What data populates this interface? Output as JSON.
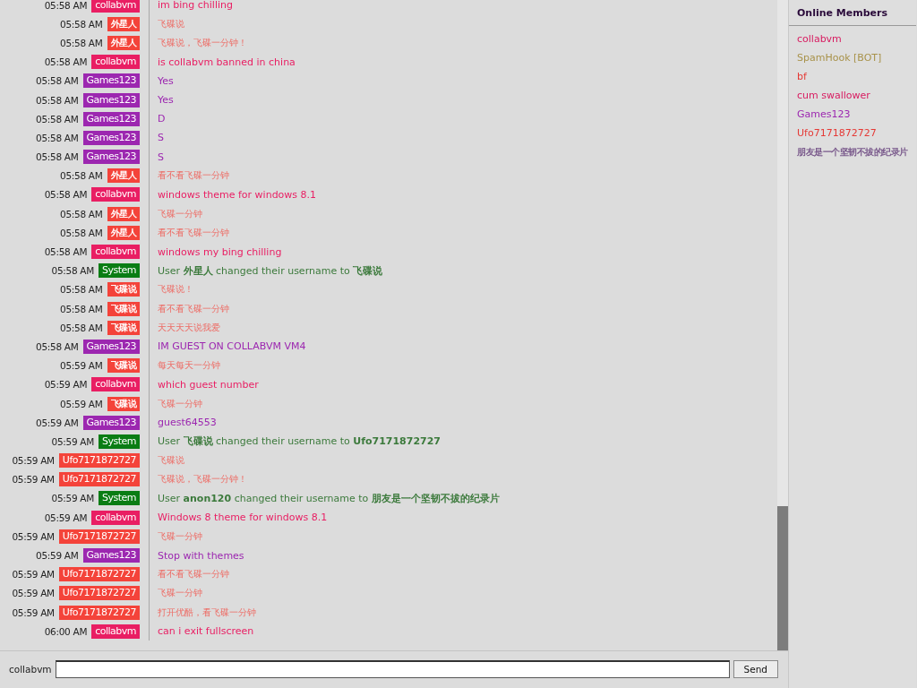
{
  "messages": [
    {
      "time": "05:58 AM",
      "user": "collabvm",
      "color": "#e91e63",
      "kind": "chat",
      "text": "im bing chilling"
    },
    {
      "time": "05:58 AM",
      "user": "外星人",
      "color": "#f4433a",
      "kind": "chat",
      "text": "飞碟说"
    },
    {
      "time": "05:58 AM",
      "user": "外星人",
      "color": "#f4433a",
      "kind": "chat",
      "text": "飞碟说，飞碟一分钟！"
    },
    {
      "time": "05:58 AM",
      "user": "collabvm",
      "color": "#e91e63",
      "kind": "chat",
      "text": "is collabvm banned in china"
    },
    {
      "time": "05:58 AM",
      "user": "Games123",
      "color": "#9c27b0",
      "kind": "chat",
      "text": "Yes"
    },
    {
      "time": "05:58 AM",
      "user": "Games123",
      "color": "#9c27b0",
      "kind": "chat",
      "text": "Yes"
    },
    {
      "time": "05:58 AM",
      "user": "Games123",
      "color": "#9c27b0",
      "kind": "chat",
      "text": "D"
    },
    {
      "time": "05:58 AM",
      "user": "Games123",
      "color": "#9c27b0",
      "kind": "chat",
      "text": "S"
    },
    {
      "time": "05:58 AM",
      "user": "Games123",
      "color": "#9c27b0",
      "kind": "chat",
      "text": "S"
    },
    {
      "time": "05:58 AM",
      "user": "外星人",
      "color": "#f4433a",
      "kind": "chat",
      "text": "看不看飞碟一分钟"
    },
    {
      "time": "05:58 AM",
      "user": "collabvm",
      "color": "#e91e63",
      "kind": "chat",
      "text": "windows theme for windows 8.1"
    },
    {
      "time": "05:58 AM",
      "user": "外星人",
      "color": "#f4433a",
      "kind": "chat",
      "text": "飞碟一分钟"
    },
    {
      "time": "05:58 AM",
      "user": "外星人",
      "color": "#f4433a",
      "kind": "chat",
      "text": "看不看飞碟一分钟"
    },
    {
      "time": "05:58 AM",
      "user": "collabvm",
      "color": "#e91e63",
      "kind": "chat",
      "text": "windows my bing chilling"
    },
    {
      "time": "05:58 AM",
      "user": "System",
      "color": "#0a7d14",
      "kind": "system",
      "text": "User **外星人** changed their username to **飞碟说**"
    },
    {
      "time": "05:58 AM",
      "user": "飞碟说",
      "color": "#f4433a",
      "kind": "chat",
      "text": "飞碟说！"
    },
    {
      "time": "05:58 AM",
      "user": "飞碟说",
      "color": "#f4433a",
      "kind": "chat",
      "text": "看不看飞碟一分钟"
    },
    {
      "time": "05:58 AM",
      "user": "飞碟说",
      "color": "#f4433a",
      "kind": "chat",
      "text": "天天天天说我爱"
    },
    {
      "time": "05:58 AM",
      "user": "Games123",
      "color": "#9c27b0",
      "kind": "chat",
      "text": "IM GUEST ON COLLABVM VM4"
    },
    {
      "time": "05:59 AM",
      "user": "飞碟说",
      "color": "#f4433a",
      "kind": "chat",
      "text": "每天每天一分钟"
    },
    {
      "time": "05:59 AM",
      "user": "collabvm",
      "color": "#e91e63",
      "kind": "chat",
      "text": "which guest number"
    },
    {
      "time": "05:59 AM",
      "user": "飞碟说",
      "color": "#f4433a",
      "kind": "chat",
      "text": "飞碟一分钟"
    },
    {
      "time": "05:59 AM",
      "user": "Games123",
      "color": "#9c27b0",
      "kind": "chat",
      "text": "guest64553"
    },
    {
      "time": "05:59 AM",
      "user": "System",
      "color": "#0a7d14",
      "kind": "system",
      "text": "User **飞碟说** changed their username to **Ufo7171872727**"
    },
    {
      "time": "05:59 AM",
      "user": "Ufo7171872727",
      "color": "#f4433a",
      "kind": "chat",
      "text": "飞碟说"
    },
    {
      "time": "05:59 AM",
      "user": "Ufo7171872727",
      "color": "#f4433a",
      "kind": "chat",
      "text": "飞碟说，飞碟一分钟！"
    },
    {
      "time": "05:59 AM",
      "user": "System",
      "color": "#0a7d14",
      "kind": "system",
      "text": "User **anon120** changed their username to **朋友是一个坚韧不拔的纪录片**"
    },
    {
      "time": "05:59 AM",
      "user": "collabvm",
      "color": "#e91e63",
      "kind": "chat",
      "text": "Windows 8 theme for windows 8.1"
    },
    {
      "time": "05:59 AM",
      "user": "Ufo7171872727",
      "color": "#f4433a",
      "kind": "chat",
      "text": "飞碟一分钟"
    },
    {
      "time": "05:59 AM",
      "user": "Games123",
      "color": "#9c27b0",
      "kind": "chat",
      "text": "Stop with themes"
    },
    {
      "time": "05:59 AM",
      "user": "Ufo7171872727",
      "color": "#f4433a",
      "kind": "chat",
      "text": "看不看飞碟一分钟"
    },
    {
      "time": "05:59 AM",
      "user": "Ufo7171872727",
      "color": "#f4433a",
      "kind": "chat",
      "text": "飞碟一分钟"
    },
    {
      "time": "05:59 AM",
      "user": "Ufo7171872727",
      "color": "#f4433a",
      "kind": "chat",
      "text": "打开优酷，看飞碟一分钟"
    },
    {
      "time": "06:00 AM",
      "user": "collabvm",
      "color": "#e91e63",
      "kind": "chat",
      "text": "can i exit fullscreen"
    }
  ],
  "input": {
    "username": "collabvm",
    "button": "Send"
  },
  "members": {
    "title": "Online Members",
    "items": [
      {
        "name": "collabvm",
        "color": "#d81b60"
      },
      {
        "name": "SpamHook [BOT]",
        "color": "#a8924a"
      },
      {
        "name": "bf",
        "color": "#e53935"
      },
      {
        "name": "cum swallower",
        "color": "#d81b60"
      },
      {
        "name": "Games123",
        "color": "#9c27b0"
      },
      {
        "name": "Ufo7171872727",
        "color": "#e53935"
      },
      {
        "name": "朋友是一个坚韧不拔的纪录片",
        "color": "#7a5a8c"
      }
    ]
  }
}
